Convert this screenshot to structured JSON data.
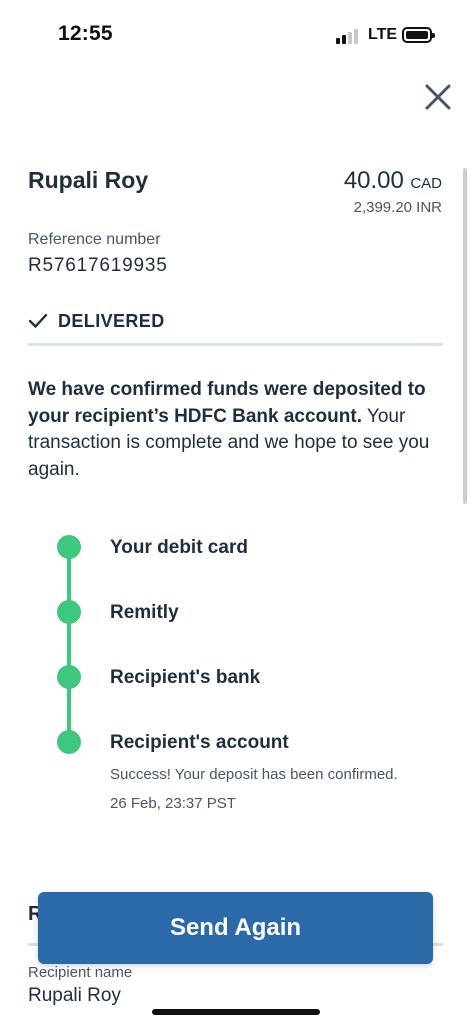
{
  "status_bar": {
    "time": "12:55",
    "network": "LTE",
    "signal_bars": 2,
    "signal_total": 4,
    "icons": [
      "signal-icon",
      "battery-icon"
    ]
  },
  "header": {
    "close_icon": "close-icon"
  },
  "transfer": {
    "recipient": "Rupali Roy",
    "amount": "40.00",
    "amount_currency": "CAD",
    "received_amount": "2,399.20 INR",
    "reference_label": "Reference number",
    "reference_number": "R57617619935",
    "status_icon": "checkmark-icon",
    "status": "DELIVERED"
  },
  "message": {
    "bold": "We have confirmed funds were deposited to your recipient’s HDFC Bank account.",
    "regular": " Your transaction is complete and we hope to see you again."
  },
  "timeline": [
    {
      "label": "Your debit card"
    },
    {
      "label": "Remitly"
    },
    {
      "label": "Recipient's bank"
    },
    {
      "label": "Recipient's account",
      "note": "Success! Your deposit has been confirmed.",
      "timestamp": "26 Feb, 23:37 PST"
    }
  ],
  "recipient_section": {
    "heading_peek": "R",
    "name_label": "Recipient name",
    "name_value": "Rupali Roy"
  },
  "actions": {
    "send_again_label": "Send Again"
  },
  "colors": {
    "accent_green": "#3ec77e",
    "button_blue": "#2a6aa8",
    "text_dark": "#1f2d3d",
    "text_muted": "#4a5563"
  }
}
